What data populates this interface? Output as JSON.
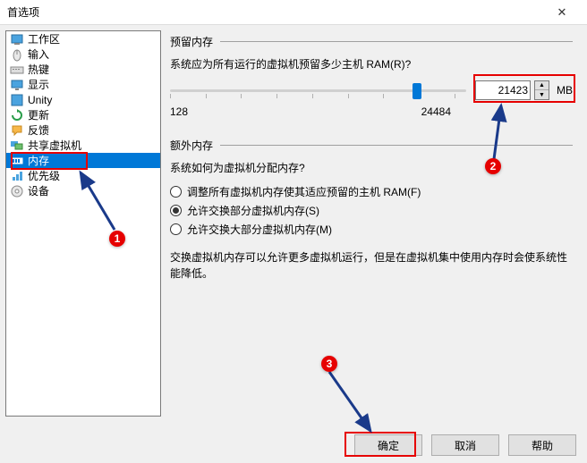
{
  "window": {
    "title": "首选项"
  },
  "sidebar": {
    "items": [
      {
        "label": "工作区"
      },
      {
        "label": "输入"
      },
      {
        "label": "热键"
      },
      {
        "label": "显示"
      },
      {
        "label": "Unity"
      },
      {
        "label": "更新"
      },
      {
        "label": "反馈"
      },
      {
        "label": "共享虚拟机"
      },
      {
        "label": "内存"
      },
      {
        "label": "优先级"
      },
      {
        "label": "设备"
      }
    ]
  },
  "reserved": {
    "group_title": "预留内存",
    "question": "系统应为所有运行的虚拟机预留多少主机 RAM(R)?",
    "min": "128",
    "max": "24484",
    "value": "21423",
    "unit": "MB"
  },
  "extra": {
    "group_title": "额外内存",
    "question": "系统如何为虚拟机分配内存?",
    "options": [
      "调整所有虚拟机内存使其适应预留的主机 RAM(F)",
      "允许交换部分虚拟机内存(S)",
      "允许交换大部分虚拟机内存(M)"
    ],
    "note": "交换虚拟机内存可以允许更多虚拟机运行，但是在虚拟机集中使用内存时会使系统性能降低。"
  },
  "buttons": {
    "ok": "确定",
    "cancel": "取消",
    "help": "帮助"
  },
  "callouts": {
    "c1": "1",
    "c2": "2",
    "c3": "3"
  }
}
